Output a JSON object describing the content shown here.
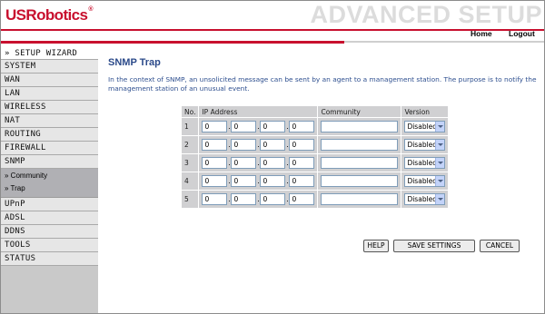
{
  "header": {
    "logo": "USRobotics",
    "logo_mark": "®",
    "title": "ADVANCED SETUP",
    "links": {
      "home": "Home",
      "logout": "Logout"
    },
    "brand_red": "#c8102e"
  },
  "sidebar": {
    "wizard": "» SETUP WIZARD",
    "items_top": [
      "SYSTEM",
      "WAN",
      "LAN",
      "WIRELESS",
      "NAT",
      "ROUTING",
      "FIREWALL",
      "SNMP"
    ],
    "snmp_sub": [
      "» Community",
      "» Trap"
    ],
    "items_bottom": [
      "UPnP",
      "ADSL",
      "DDNS",
      "TOOLS",
      "STATUS"
    ]
  },
  "main": {
    "title": "SNMP Trap",
    "description": "In the context of SNMP, an unsolicited message can be sent by an agent to a management station. The purpose is to notify the management station of an unusual event.",
    "table": {
      "headers": {
        "no": "No.",
        "ip": "IP Address",
        "community": "Community",
        "version": "Version"
      },
      "rows": [
        {
          "no": "1",
          "ip": [
            "0",
            "0",
            "0",
            "0"
          ],
          "community": "",
          "version": "Disabled"
        },
        {
          "no": "2",
          "ip": [
            "0",
            "0",
            "0",
            "0"
          ],
          "community": "",
          "version": "Disabled"
        },
        {
          "no": "3",
          "ip": [
            "0",
            "0",
            "0",
            "0"
          ],
          "community": "",
          "version": "Disabled"
        },
        {
          "no": "4",
          "ip": [
            "0",
            "0",
            "0",
            "0"
          ],
          "community": "",
          "version": "Disabled"
        },
        {
          "no": "5",
          "ip": [
            "0",
            "0",
            "0",
            "0"
          ],
          "community": "",
          "version": "Disabled"
        }
      ]
    },
    "buttons": {
      "help": "HELP",
      "save": "SAVE SETTINGS",
      "cancel": "CANCEL"
    }
  }
}
